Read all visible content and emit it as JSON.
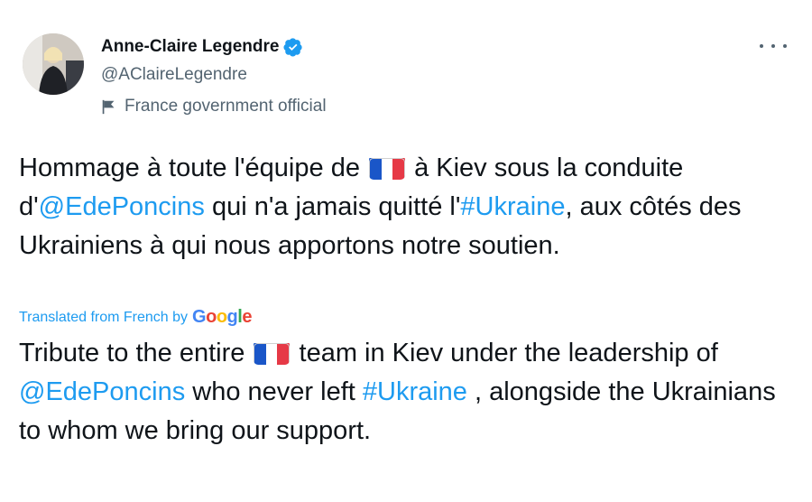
{
  "author": {
    "name": "Anne-Claire Legendre",
    "handle": "@AClaireLegendre",
    "label": "France government official",
    "avatar_icon": "profile-photo",
    "verified_icon": "verified-badge-icon",
    "label_icon": "flag-icon"
  },
  "menu_icon": "more-options-icon",
  "tweet": {
    "original": {
      "part1": "Hommage à toute l'équipe de ",
      "flag": "france-flag-emoji",
      "part2": " à Kiev sous la conduite d'",
      "mention": "@EdePoncins",
      "part3": " qui n'a jamais quitté l'",
      "hashtag": "#Ukraine",
      "part4": ", aux côtés des Ukrainiens à qui nous apportons notre soutien."
    },
    "translation_label": "Translated from French by",
    "translation_provider": [
      "G",
      "o",
      "o",
      "g",
      "l",
      "e"
    ],
    "translated": {
      "part1": "Tribute to the entire ",
      "flag": "france-flag-emoji",
      "part2": " team in Kiev under the leadership of ",
      "mention": "@EdePoncins",
      "part3": " who never left ",
      "hashtag": "#Ukraine",
      "part4": " , alongside the Ukrainians to whom we bring our support."
    }
  },
  "colors": {
    "link": "#1d9bf0",
    "secondary_text": "#536471",
    "verified": "#1d9bf0",
    "france_blue": "#1a56c8",
    "france_red": "#e63946"
  }
}
